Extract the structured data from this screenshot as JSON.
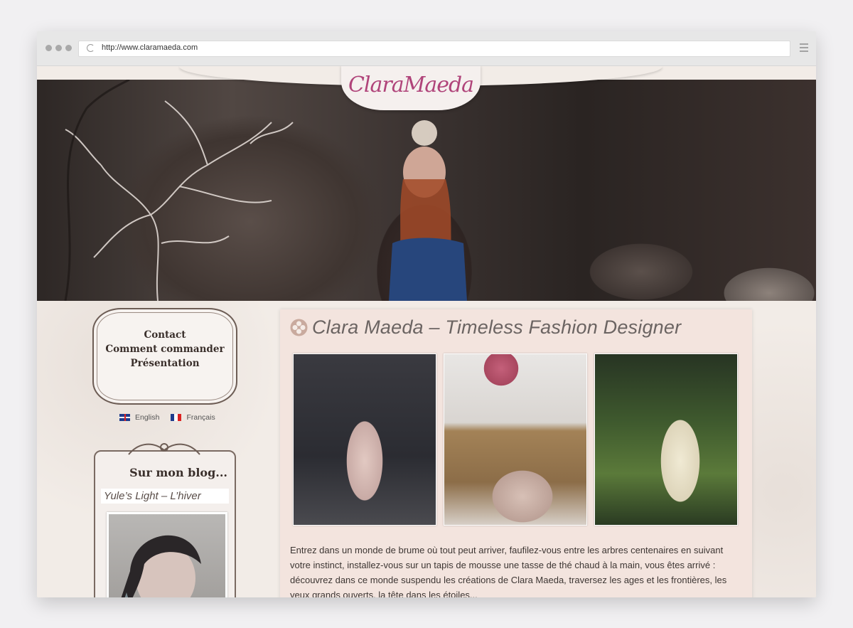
{
  "browser": {
    "url": "http://www.claramaeda.com"
  },
  "header": {
    "logo_text": "ClaraMaeda"
  },
  "sidebar": {
    "menu": [
      {
        "label": "Contact"
      },
      {
        "label": "Comment commander"
      },
      {
        "label": "Présentation"
      }
    ],
    "languages": [
      {
        "label": "English",
        "flag": "uk-flag-icon"
      },
      {
        "label": "Français",
        "flag": "france-flag-icon"
      }
    ],
    "blog": {
      "heading": "Sur mon blog...",
      "post_title": "Yule’s Light – L’hiver"
    }
  },
  "main": {
    "title": "Clara Maeda – Timeless Fashion Designer",
    "intro": "Entrez dans un monde de brume où tout peut arriver, faufilez-vous entre les arbres centenaires en suivant votre instinct, installez-vous sur un tapis de mousse une tasse de thé chaud à la main, vous êtes arrivé : découvrez dans ce monde suspendu les créations de Clara Maeda, traversez les ages et les frontières, les yeux grands ouverts, la tête dans les étoiles..."
  },
  "colors": {
    "logo_pink": "#b0447a",
    "page_background": "#f2ece7",
    "content_panel": "#f3e4de"
  }
}
